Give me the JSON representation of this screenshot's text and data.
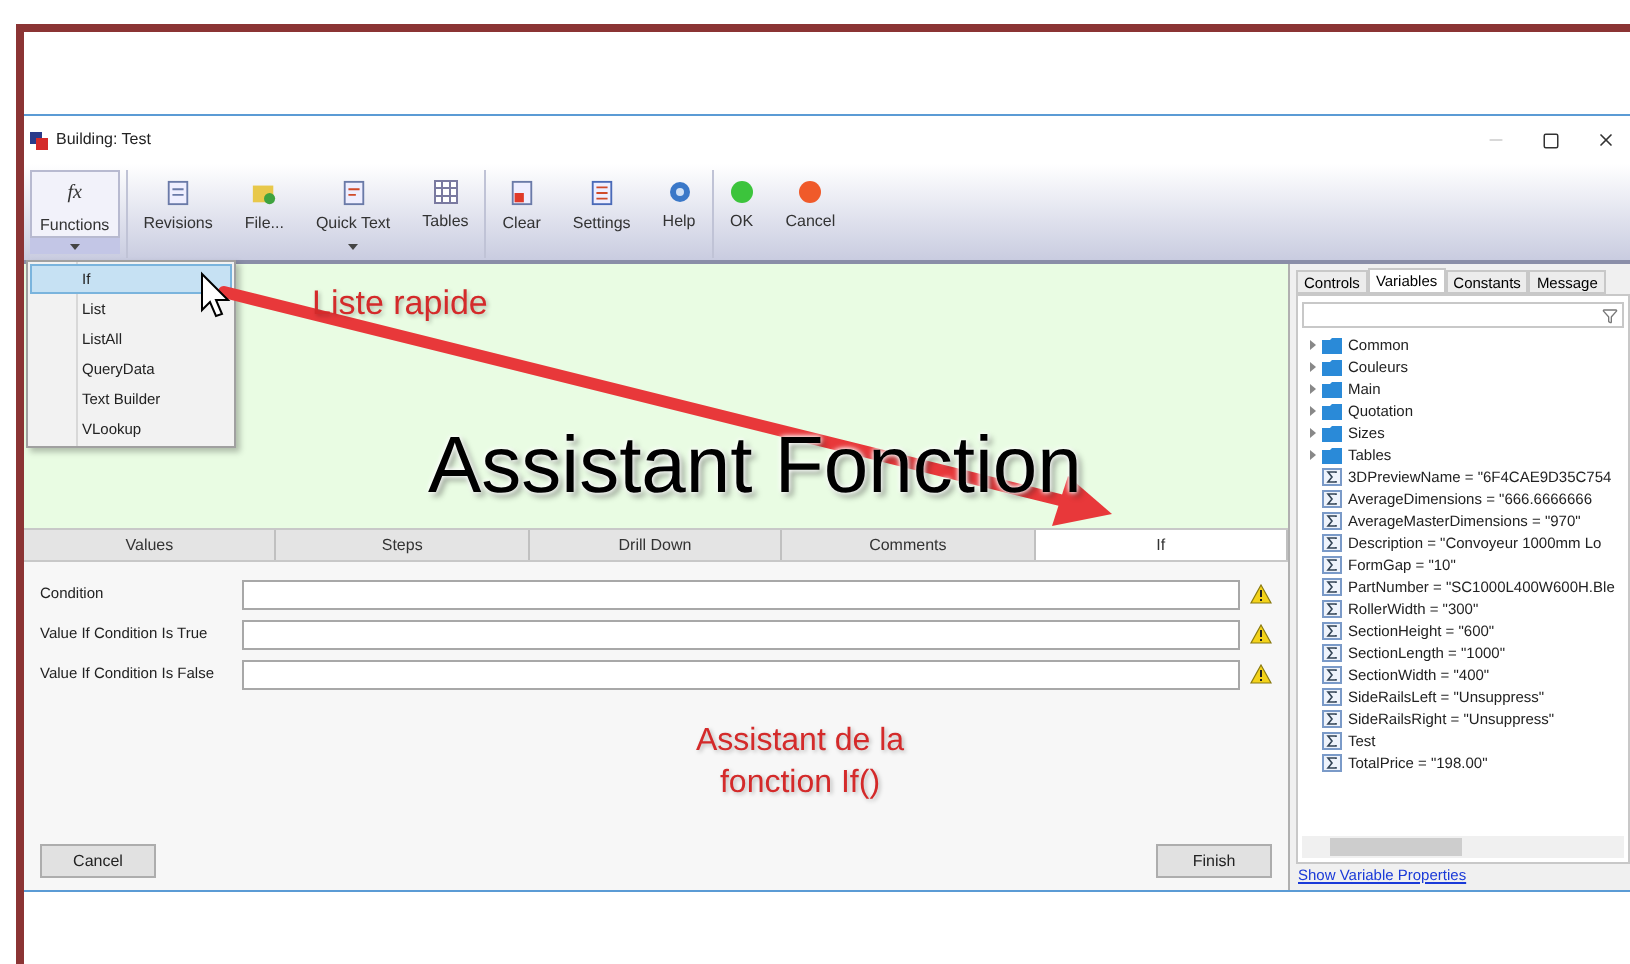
{
  "window": {
    "title": "Building: Test"
  },
  "ribbon": {
    "groups": [
      [
        {
          "kind": "functions",
          "glyph": "fx",
          "label": "Functions",
          "has_dropdown": true,
          "pressed": true
        }
      ],
      [
        {
          "kind": "revisions",
          "label": "Revisions",
          "has_dropdown": false,
          "pressed": false
        },
        {
          "kind": "file",
          "label": "File...",
          "has_dropdown": false,
          "pressed": false
        },
        {
          "kind": "quick_text",
          "label": "Quick Text",
          "has_dropdown": true,
          "pressed": false
        },
        {
          "kind": "tables",
          "label": "Tables",
          "has_dropdown": false,
          "pressed": false
        }
      ],
      [
        {
          "kind": "clear",
          "label": "Clear",
          "has_dropdown": false,
          "pressed": false
        },
        {
          "kind": "settings",
          "label": "Settings",
          "has_dropdown": false,
          "pressed": false
        },
        {
          "kind": "help",
          "label": "Help",
          "has_dropdown": false,
          "pressed": false
        }
      ],
      [
        {
          "kind": "ok",
          "label": "OK",
          "has_dropdown": false,
          "pressed": false
        },
        {
          "kind": "cancel",
          "label": "Cancel",
          "has_dropdown": false,
          "pressed": false
        }
      ]
    ]
  },
  "functions_menu": [
    {
      "label": "If",
      "selected": true
    },
    {
      "label": "List",
      "selected": false
    },
    {
      "label": "ListAll",
      "selected": false
    },
    {
      "label": "QueryData",
      "selected": false
    },
    {
      "label": "Text Builder",
      "selected": false
    },
    {
      "label": "VLookup",
      "selected": false
    }
  ],
  "tabs": [
    {
      "label": "Values",
      "selected": false
    },
    {
      "label": "Steps",
      "selected": false
    },
    {
      "label": "Drill Down",
      "selected": false
    },
    {
      "label": "Comments",
      "selected": false
    },
    {
      "label": "If",
      "selected": true
    }
  ],
  "form": {
    "fields": [
      {
        "label": "Condition",
        "warning": true
      },
      {
        "label": "Value If Condition Is True",
        "warning": true
      },
      {
        "label": "Value If Condition Is False",
        "warning": true
      }
    ],
    "buttons": [
      "Cancel",
      "Finish"
    ]
  },
  "side_panel": {
    "tabs": [
      {
        "label": "Controls",
        "selected": false
      },
      {
        "label": "Variables",
        "selected": true
      },
      {
        "label": "Constants",
        "selected": false
      },
      {
        "label": "Message",
        "selected": false
      }
    ],
    "tree": [
      {
        "kind": "folder",
        "label": "Common",
        "expanded": false
      },
      {
        "kind": "folder",
        "label": "Couleurs",
        "expanded": false
      },
      {
        "kind": "folder",
        "label": "Main",
        "expanded": false
      },
      {
        "kind": "folder",
        "label": "Quotation",
        "expanded": false
      },
      {
        "kind": "folder",
        "label": "Sizes",
        "expanded": false
      },
      {
        "kind": "folder",
        "label": "Tables",
        "expanded": false
      },
      {
        "kind": "variable",
        "label": "3DPreviewName = \"6F4CAE9D35C754"
      },
      {
        "kind": "variable",
        "label": "AverageDimensions = \"666.6666666"
      },
      {
        "kind": "variable",
        "label": "AverageMasterDimensions = \"970\""
      },
      {
        "kind": "variable",
        "label": "Description = \"Convoyeur 1000mm Lo"
      },
      {
        "kind": "variable",
        "label": "FormGap = \"10\""
      },
      {
        "kind": "variable",
        "label": "PartNumber = \"SC1000L400W600H.Ble"
      },
      {
        "kind": "variable",
        "label": "RollerWidth = \"300\""
      },
      {
        "kind": "variable",
        "label": "SectionHeight = \"600\""
      },
      {
        "kind": "variable",
        "label": "SectionLength = \"1000\""
      },
      {
        "kind": "variable",
        "label": "SectionWidth = \"400\""
      },
      {
        "kind": "variable",
        "label": "SideRailsLeft = \"Unsuppress\""
      },
      {
        "kind": "variable",
        "label": "SideRailsRight = \"Unsuppress\""
      },
      {
        "kind": "variable",
        "label": "Test"
      },
      {
        "kind": "variable",
        "label": "TotalPrice = \"198.00\""
      }
    ],
    "link": "Show Variable Properties"
  },
  "annotations": {
    "quick_list": "Liste rapide",
    "title": "Assistant Fonction",
    "caption": "Assistant de la fonction If()"
  }
}
